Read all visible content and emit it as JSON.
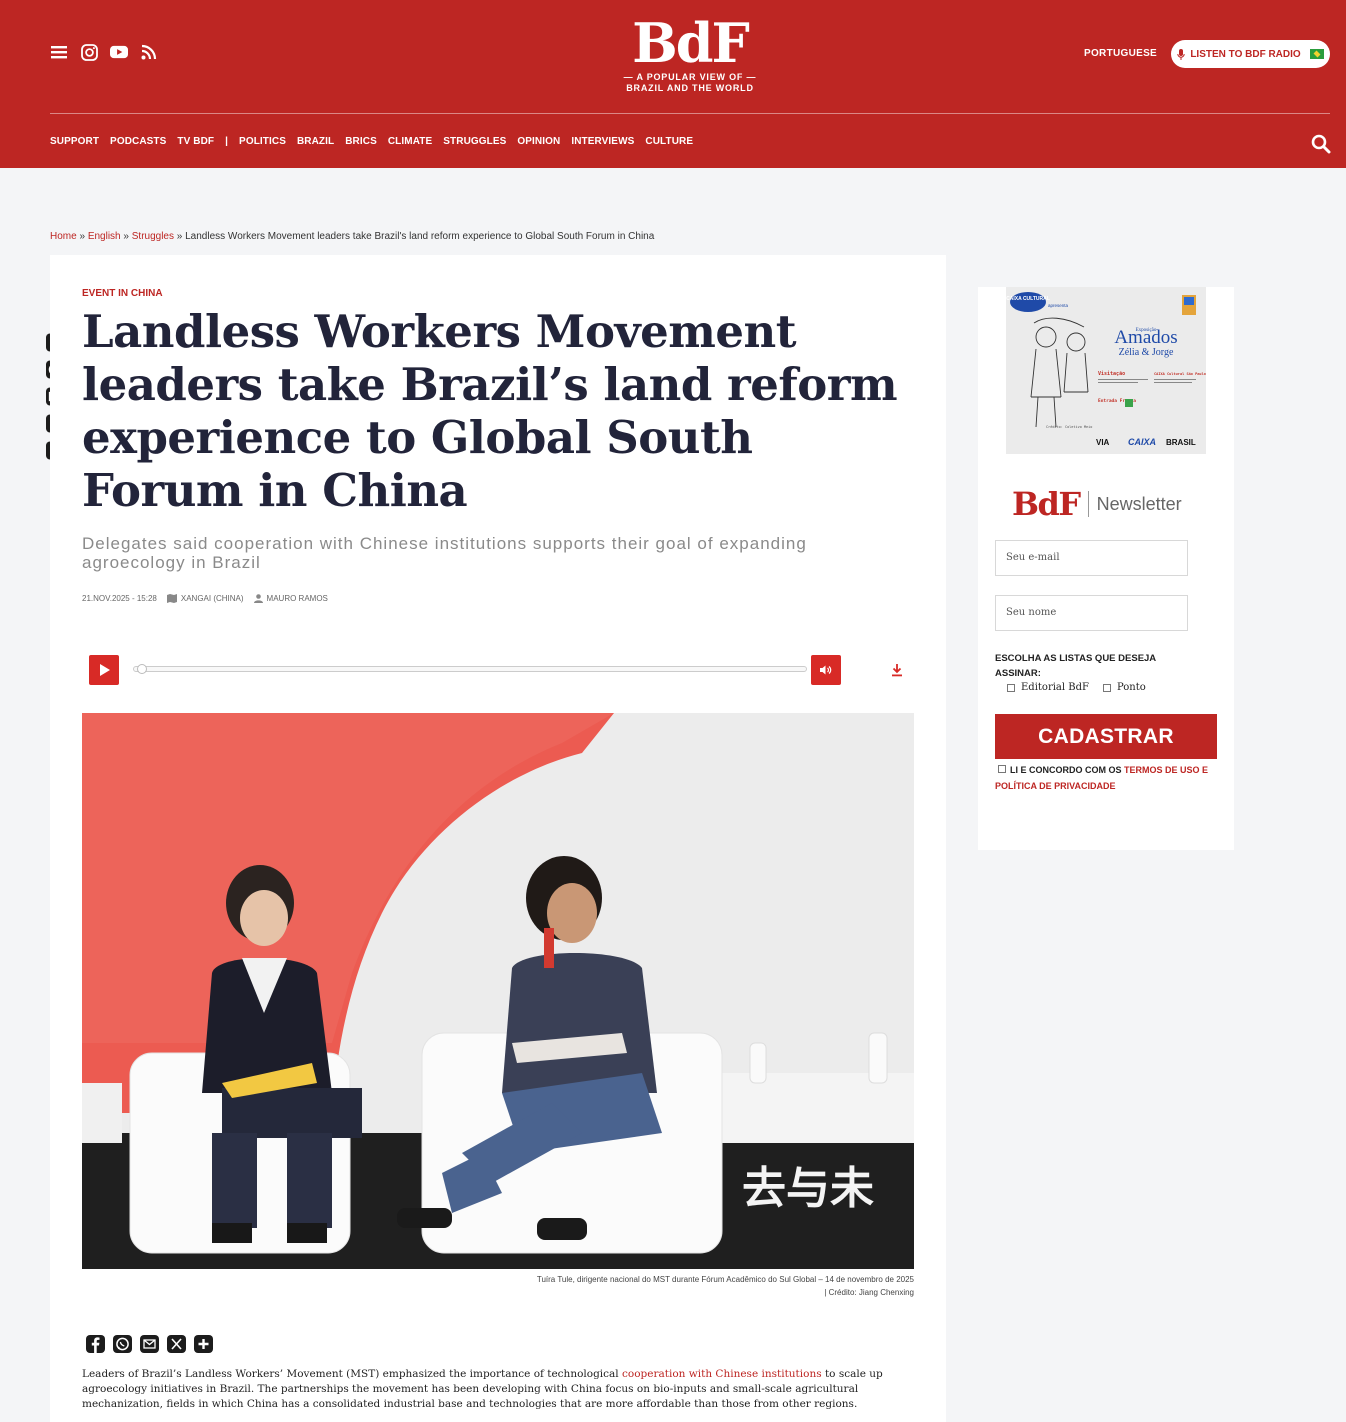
{
  "header": {
    "logo": "BdF",
    "tagline_line1": "— A POPULAR VIEW OF —",
    "tagline_line2": "BRAZIL AND THE WORLD",
    "language": "PORTUGUESE",
    "radio_label": "LISTEN TO BDF RADIO",
    "social_icons": [
      "menu-icon",
      "instagram-icon",
      "youtube-icon",
      "rss-icon"
    ],
    "nav": [
      "SUPPORT",
      "PODCASTS",
      "TV BDF",
      "|",
      "POLITICS",
      "BRAZIL",
      "BRICS",
      "CLIMATE",
      "STRUGGLES",
      "OPINION",
      "INTERVIEWS",
      "CULTURE"
    ],
    "brand_color": "#bd2623"
  },
  "breadcrumb": {
    "home": "Home",
    "english": "English",
    "struggles": "Struggles",
    "current": "Landless Workers Movement leaders take Brazil's land reform experience to Global South Forum in China"
  },
  "share_icons": [
    "facebook-icon",
    "whatsapp-icon",
    "email-icon",
    "x-icon",
    "plus-icon"
  ],
  "article": {
    "kicker": "EVENT IN CHINA",
    "title": "Landless Workers Movement leaders take Brazil’s land reform experience to Global South Forum in China",
    "subtitle": "Delegates said cooperation with Chinese institutions supports their goal of expanding agroecology in Brazil",
    "date": "21.NOV.2025 - 15:28",
    "location": "XANGAI (CHINA)",
    "author": "MAURO RAMOS",
    "caption_line1": "Tuíra Tule, dirigente nacional do MST durante Fórum Acadêmico do Sul Global – 14 de novembro de 2025",
    "caption_line2": "| Crédito: Jiang Chenxing",
    "photo_banner_text": "去与未",
    "body_before": "Leaders of Brazil’s Landless Workers’ Movement (MST) emphasized the importance of technological ",
    "body_link": "cooperation with Chinese institutions",
    "body_after": " to scale up agroecology initiatives in Brazil. The partnerships the movement has been developing with China focus on bio-inputs and small-scale agricultural mechanization, fields in which China has a consolidated industrial base and technologies that are more affordable than those from other regions."
  },
  "sidebar": {
    "ad": {
      "badge": "CAIXA CULTURAL",
      "badge_sub": "apresenta",
      "title": "Amados",
      "subtitle": "Zélia & Jorge",
      "exposicao": "Exposição",
      "visitacao": "Visitação",
      "entrada": "Entrada Franca",
      "venue": "CAIXA Cultural São Paulo",
      "credit": "Crédito: Coletivo Meio",
      "sponsor1": "VIA",
      "sponsor2": "CAIXA",
      "sponsor3": "BRASIL"
    },
    "newsletter": {
      "logo": "BdF",
      "label": "Newsletter",
      "email_placeholder": "Seu e-mail",
      "name_placeholder": "Seu nome",
      "lists_label": "ESCOLHA AS LISTAS QUE DESEJA ASSINAR:",
      "list1": "Editorial BdF",
      "list2": "Ponto",
      "submit": "CADASTRAR",
      "terms_prefix": "LI E CONCORDO COM OS ",
      "terms_link": "TERMOS DE USO E POLÍTICA DE PRIVACIDADE"
    }
  }
}
